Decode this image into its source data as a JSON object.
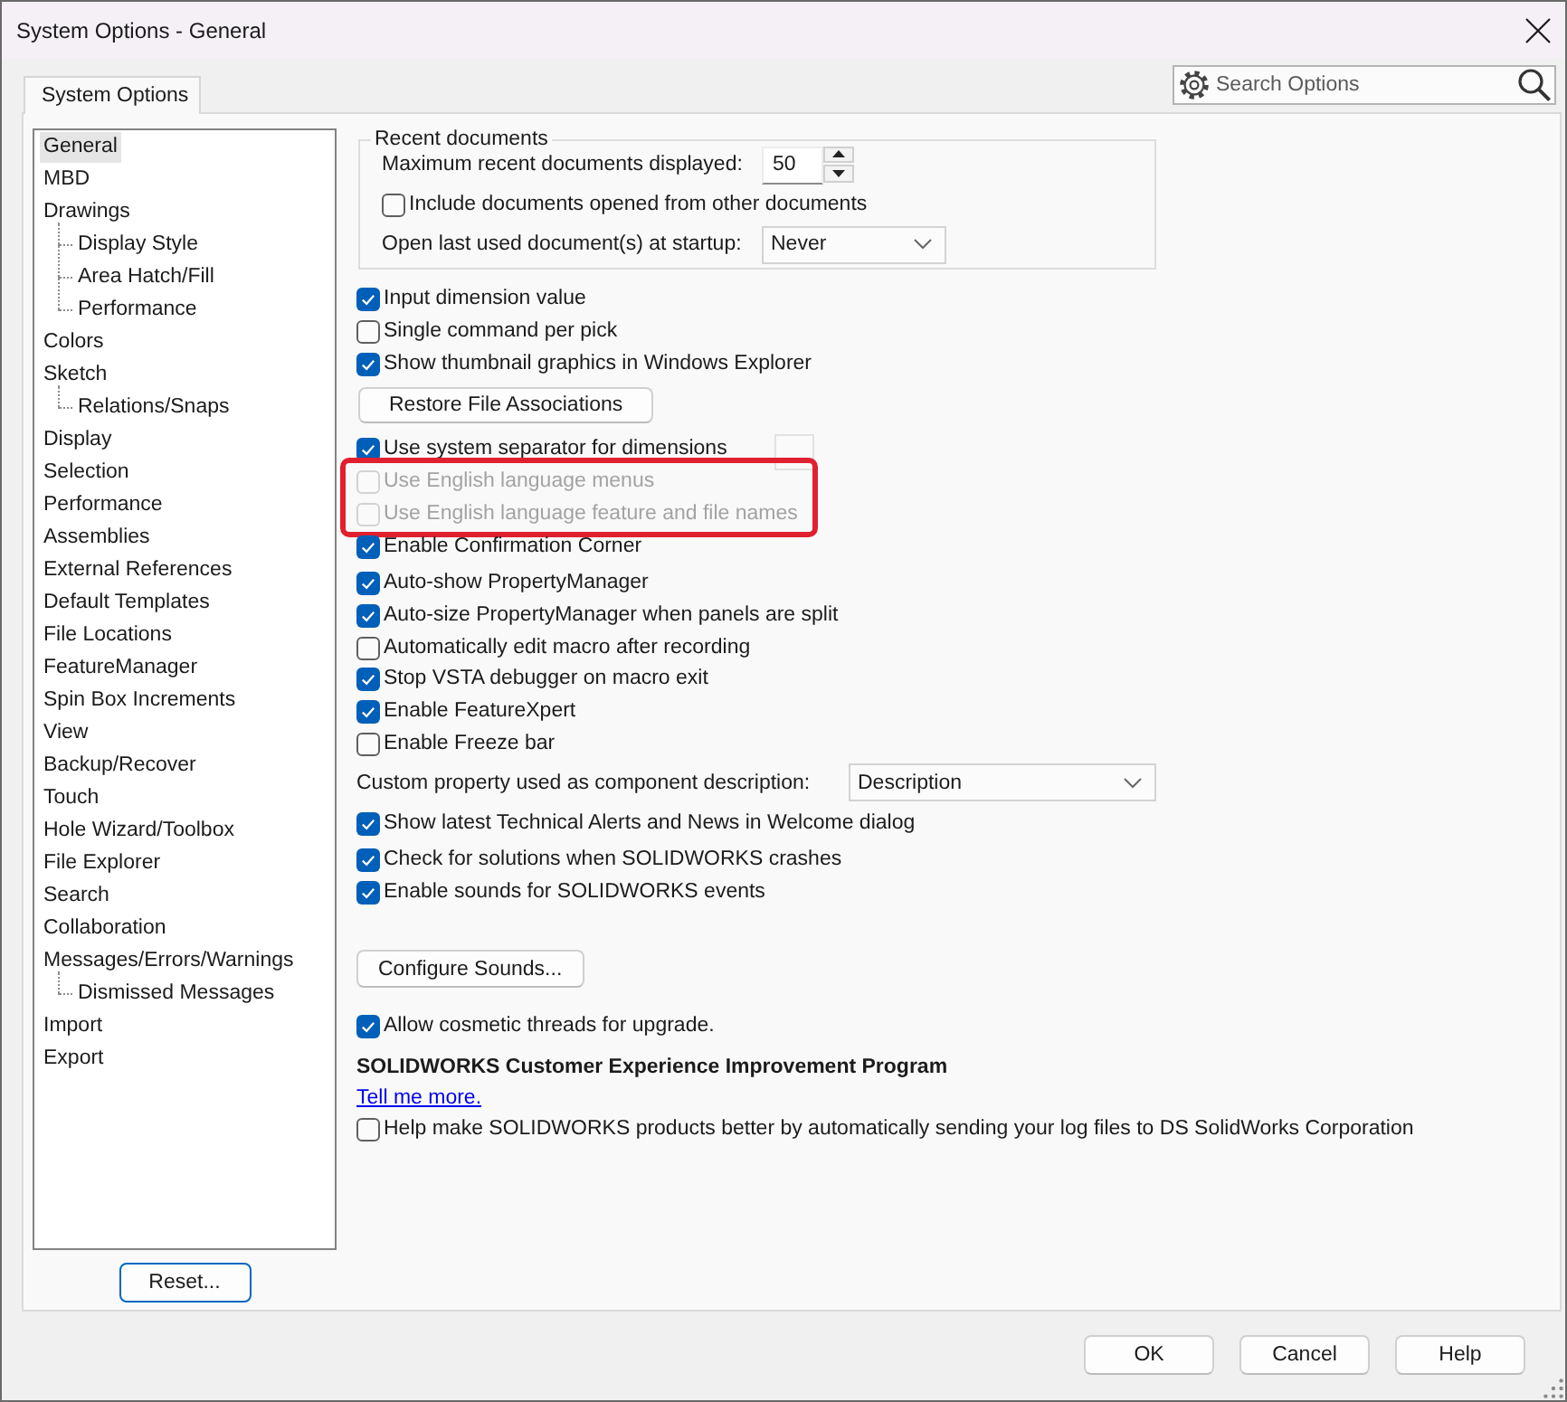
{
  "window": {
    "title": "System Options - General"
  },
  "tabs": [
    {
      "label": "System Options",
      "selected": true
    }
  ],
  "search": {
    "placeholder": "Search Options"
  },
  "tree": {
    "items": [
      {
        "label": "General",
        "selected": true
      },
      {
        "label": "MBD",
        "selected": false
      },
      {
        "label": "Drawings",
        "selected": false,
        "children": [
          {
            "label": "Display Style",
            "selected": false
          },
          {
            "label": "Area Hatch/Fill",
            "selected": false
          },
          {
            "label": "Performance",
            "selected": false
          }
        ]
      },
      {
        "label": "Colors",
        "selected": false
      },
      {
        "label": "Sketch",
        "selected": false,
        "children": [
          {
            "label": "Relations/Snaps",
            "selected": false
          }
        ]
      },
      {
        "label": "Display",
        "selected": false
      },
      {
        "label": "Selection",
        "selected": false
      },
      {
        "label": "Performance",
        "selected": false
      },
      {
        "label": "Assemblies",
        "selected": false
      },
      {
        "label": "External References",
        "selected": false
      },
      {
        "label": "Default Templates",
        "selected": false
      },
      {
        "label": "File Locations",
        "selected": false
      },
      {
        "label": "FeatureManager",
        "selected": false
      },
      {
        "label": "Spin Box Increments",
        "selected": false
      },
      {
        "label": "View",
        "selected": false
      },
      {
        "label": "Backup/Recover",
        "selected": false
      },
      {
        "label": "Touch",
        "selected": false
      },
      {
        "label": "Hole Wizard/Toolbox",
        "selected": false
      },
      {
        "label": "File Explorer",
        "selected": false
      },
      {
        "label": "Search",
        "selected": false
      },
      {
        "label": "Collaboration",
        "selected": false
      },
      {
        "label": "Messages/Errors/Warnings",
        "selected": false,
        "children": [
          {
            "label": "Dismissed Messages",
            "selected": false
          }
        ]
      },
      {
        "label": "Import",
        "selected": false
      },
      {
        "label": "Export",
        "selected": false
      }
    ]
  },
  "reset_button": "Reset...",
  "recent_documents": {
    "title": "Recent documents",
    "max_label": "Maximum recent documents displayed:",
    "max_value": "50",
    "include_other": {
      "label": "Include documents opened from other documents",
      "checked": false
    },
    "startup_label": "Open last used document(s) at startup:",
    "startup_value": "Never"
  },
  "options": [
    {
      "kind": "checkbox",
      "label": "Input dimension value",
      "checked": true,
      "disabled": false
    },
    {
      "kind": "checkbox",
      "label": "Single command per pick",
      "checked": false,
      "disabled": false
    },
    {
      "kind": "checkbox",
      "label": "Show thumbnail graphics in Windows Explorer",
      "checked": true,
      "disabled": false
    },
    {
      "kind": "button",
      "label": "Restore File Associations"
    },
    {
      "kind": "checkbox_field",
      "label": "Use system separator for dimensions",
      "checked": true,
      "disabled": false
    },
    {
      "kind": "frame",
      "items": [
        {
          "kind": "checkbox",
          "label": "Use English language menus",
          "checked": false,
          "disabled": true
        },
        {
          "kind": "checkbox",
          "label": "Use English language feature and file names",
          "checked": false,
          "disabled": true
        }
      ]
    },
    {
      "kind": "checkbox",
      "label": "Enable Confirmation Corner",
      "checked": true,
      "disabled": false
    },
    {
      "kind": "checkbox",
      "label": "Auto-show PropertyManager",
      "checked": true,
      "disabled": false
    },
    {
      "kind": "checkbox",
      "label": "Auto-size PropertyManager when panels are split",
      "checked": true,
      "disabled": false
    },
    {
      "kind": "checkbox",
      "label": "Automatically edit macro after recording",
      "checked": false,
      "disabled": false
    },
    {
      "kind": "checkbox",
      "label": "Stop VSTA debugger on macro exit",
      "checked": true,
      "disabled": false
    },
    {
      "kind": "checkbox",
      "label": "Enable FeatureXpert",
      "checked": true,
      "disabled": false
    },
    {
      "kind": "checkbox",
      "label": "Enable Freeze bar",
      "checked": false,
      "disabled": false
    },
    {
      "kind": "dropdown",
      "label": "Custom property used as component description:",
      "value": "Description"
    },
    {
      "kind": "checkbox",
      "label": "Show latest Technical Alerts and News in Welcome dialog",
      "checked": true,
      "disabled": false
    },
    {
      "kind": "checkbox",
      "label": "Check for solutions when SOLIDWORKS crashes",
      "checked": true,
      "disabled": false
    },
    {
      "kind": "checkbox",
      "label": "Enable sounds for SOLIDWORKS events",
      "checked": true,
      "disabled": false
    },
    {
      "kind": "button",
      "label": "Configure Sounds..."
    },
    {
      "kind": "checkbox",
      "label": "Allow cosmetic threads for upgrade.",
      "checked": true,
      "disabled": false
    },
    {
      "kind": "heading",
      "text": "SOLIDWORKS Customer Experience Improvement Program"
    },
    {
      "kind": "link",
      "text": "Tell me more."
    },
    {
      "kind": "checkbox",
      "label": "Help make SOLIDWORKS products better by automatically sending your log files to DS SolidWorks Corporation",
      "checked": false,
      "disabled": false
    }
  ],
  "buttons": [
    "OK",
    "Cancel",
    "Help"
  ]
}
